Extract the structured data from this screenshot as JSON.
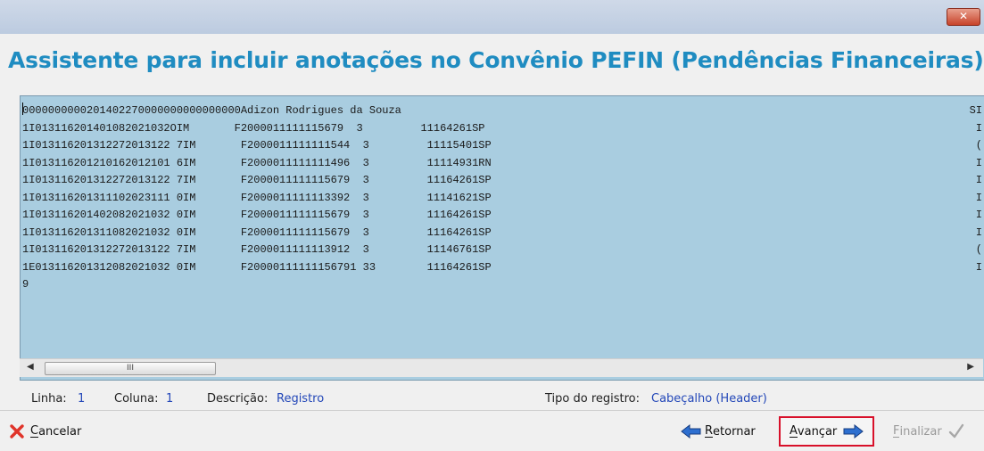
{
  "window": {
    "close_glyph": "✕"
  },
  "title": "Assistente para incluir anotações no Convênio PEFIN (Pendências Financeiras)",
  "editor": {
    "lines": [
      "0000000000201402270000000000000000Adizon Rodrigues da Souza",
      "1I013116201401082021032OIM       F2000011111115679  3         11164261SP",
      "1I013116201312272013122 7IM       F2000011111111544  3         11115401SP",
      "1I013116201210162012101 6IM       F2000011111111496  3         11114931RN",
      "1I013116201312272013122 7IM       F2000011111115679  3         11164261SP",
      "1I013116201311102023111 0IM       F2000011111113392  3         11141621SP",
      "1I013116201402082021032 0IM       F2000011111115679  3         11164261SP",
      "1I013116201311082021032 0IM       F2000011111115679  3         11164261SP",
      "1I013116201312272013122 7IM       F2000011111113912  3         11146761SP",
      "1E013116201312082021032 0IM       F20000111111156791 33        11164261SP",
      "9"
    ],
    "right_col": [
      "SI",
      "I",
      "(",
      "I",
      "I",
      "I",
      "I",
      "I",
      "(",
      "I",
      ""
    ],
    "scroll_thumb": "III"
  },
  "status": {
    "linha_label": "Linha:",
    "linha_value": "1",
    "coluna_label": "Coluna:",
    "coluna_value": "1",
    "descricao_label": "Descrição:",
    "descricao_value": "Registro",
    "tipo_label": "Tipo do registro:",
    "tipo_value": "Cabeçalho (Header)"
  },
  "buttons": {
    "cancelar_u": "C",
    "cancelar_rest": "ancelar",
    "retornar_u": "R",
    "retornar_rest": "etornar",
    "avancar_u": "A",
    "avancar_rest": "vançar",
    "finalizar_u": "F",
    "finalizar_rest": "inalizar"
  },
  "colors": {
    "title": "#1f8cc1",
    "editor_bg": "#a9cde0",
    "highlight": "#d8102a",
    "value_text": "#2347b8"
  }
}
